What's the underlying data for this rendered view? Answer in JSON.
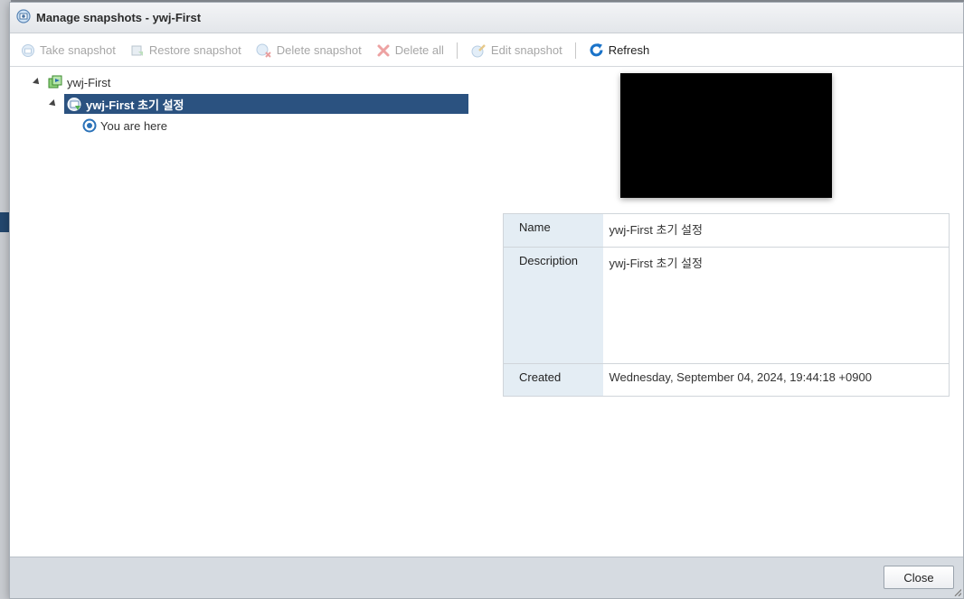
{
  "window": {
    "title": "Manage snapshots - ywj-First"
  },
  "toolbar": {
    "take": "Take snapshot",
    "restore": "Restore snapshot",
    "delete": "Delete snapshot",
    "delete_all": "Delete all",
    "edit": "Edit snapshot",
    "refresh": "Refresh"
  },
  "tree": {
    "vm": "ywj-First",
    "snapshot": "ywj-First 초기 설정",
    "current": "You are here"
  },
  "details": {
    "name_label": "Name",
    "name_value": "ywj-First 초기 설정",
    "description_label": "Description",
    "description_value": "ywj-First 초기 설정",
    "created_label": "Created",
    "created_value": "Wednesday, September 04, 2024, 19:44:18 +0900"
  },
  "footer": {
    "close": "Close"
  },
  "colors": {
    "selection": "#2b5280",
    "refresh_icon": "#1a73c9",
    "delete_x": "#e8a0a0",
    "details_key_bg": "#e4edf4"
  },
  "icons": [
    "snapshot-manager-icon",
    "take-snapshot-icon",
    "restore-snapshot-icon",
    "delete-snapshot-icon",
    "delete-all-icon",
    "edit-snapshot-icon",
    "refresh-icon",
    "vm-icon",
    "snapshot-icon",
    "you-are-here-icon"
  ]
}
